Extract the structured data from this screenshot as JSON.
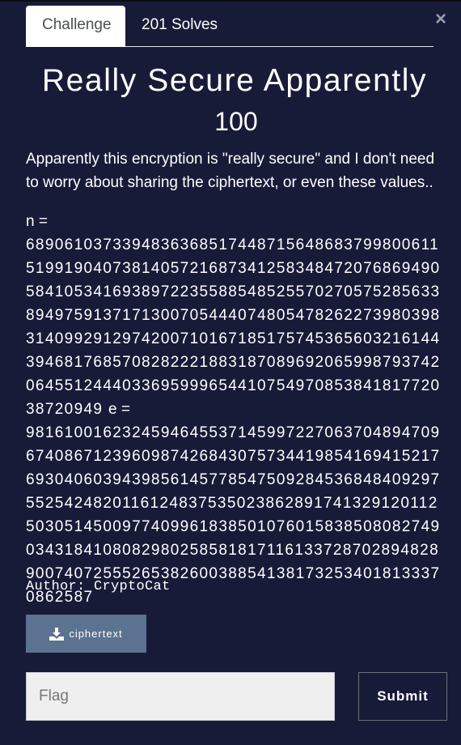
{
  "tabs": [
    {
      "label": "Challenge"
    },
    {
      "label": "201 Solves"
    }
  ],
  "close_icon": "×",
  "challenge": {
    "title": "Really Secure Apparently",
    "value": "100",
    "description": "Apparently this encryption is \"really secure\" and I don't need to worry about sharing the ciphertext, or even these values..",
    "n_label": "n =",
    "n": "689061037339483636851744871564868379980061151991904073814057216873412583484720768694905841053416938972235588548525570270575285633894975913717130070544407480547826227398039831409929129742007101671851757453656032161443946817685708282221883187089692065998793742064551244403369599965441075497085384181772038720949",
    "e_label": "e =",
    "e": "98161001623245946455371459972270637048947096740867123960987426843075734419854169415217693040603943985614577854750928453684840929755254248201161248375350238628917413291201125030514500977409961838501076015838508082749034318410808298025858181711613372870289482890074072555265382600388541381732534018133370862587",
    "author": "Author: CryptoCat"
  },
  "download": {
    "label": "ciphertext",
    "icon": "download-icon"
  },
  "flag_input": {
    "placeholder": "Flag",
    "value": ""
  },
  "submit_label": "Submit"
}
